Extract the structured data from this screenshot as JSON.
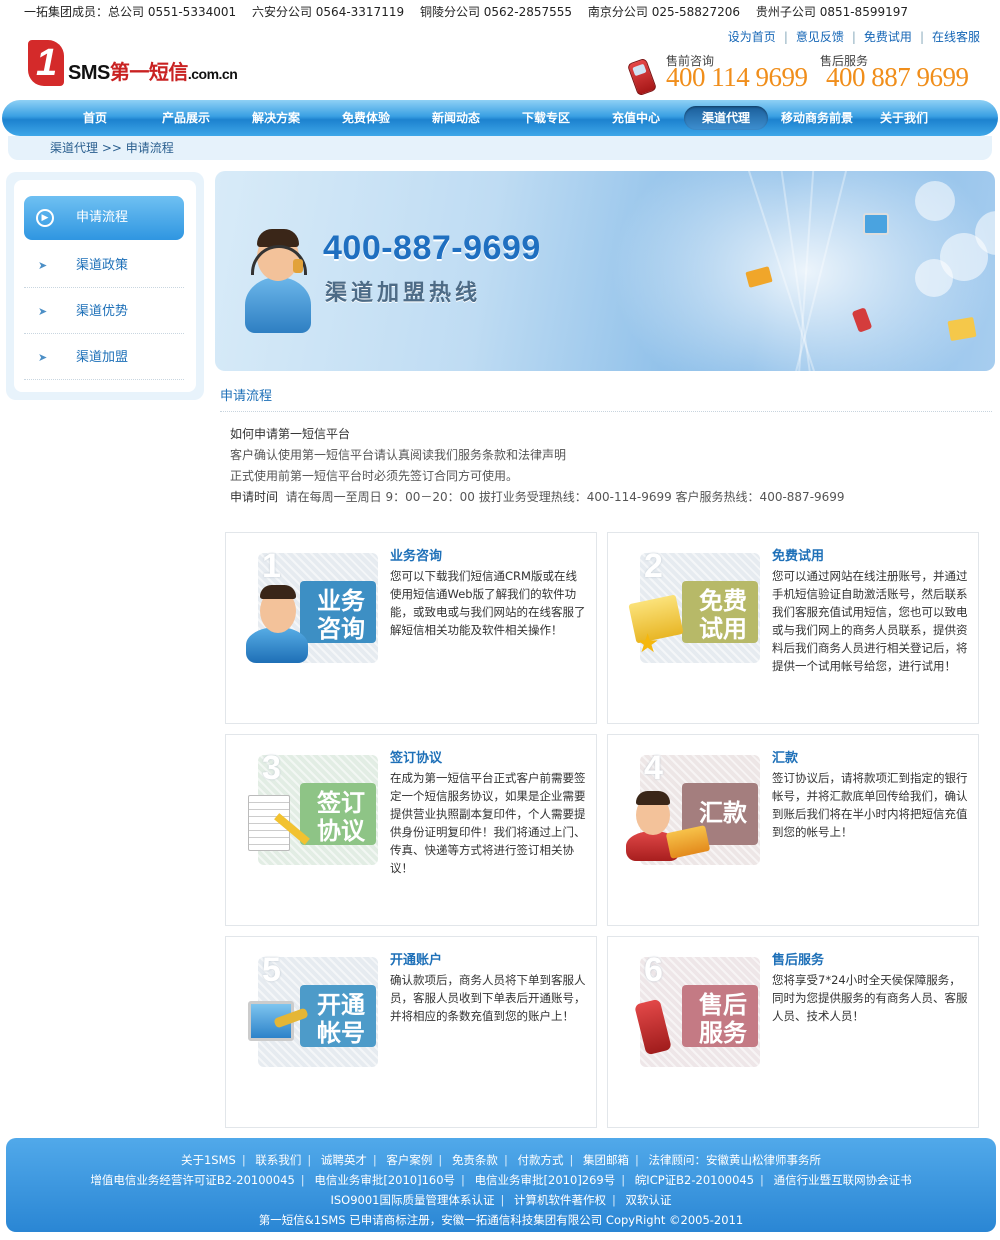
{
  "topbar": {
    "items": [
      "一拓集团成员：总公司 0551-5334001",
      "六安分公司 0564-3317119",
      "铜陵分公司 0562-2857555",
      "南京分公司 025-58827206",
      "贵州子公司 0851-8599197"
    ]
  },
  "header": {
    "logo_mark": "1",
    "logo_sms": "SMS",
    "logo_cn": "第一短信",
    "logo_domain": ".com.cn",
    "links": [
      "设为首页",
      "意见反馈",
      "免费试用",
      "在线客服"
    ],
    "presale_label": "售前咨询",
    "presale_number": "400 114 9699",
    "aftersale_label": "售后服务",
    "aftersale_number": "400 887 9699"
  },
  "nav": {
    "items": [
      "首页",
      "产品展示",
      "解决方案",
      "免费体验",
      "新闻动态",
      "下载专区",
      "充值中心",
      "渠道代理",
      "移动商务前景",
      "关于我们"
    ],
    "active": "渠道代理"
  },
  "breadcrumb": {
    "parent": "渠道代理",
    "sep": ">>",
    "current": "申请流程"
  },
  "sidebar": {
    "items": [
      "申请流程",
      "渠道政策",
      "渠道优势",
      "渠道加盟"
    ],
    "active": "申请流程"
  },
  "banner": {
    "number": "400-887-9699",
    "subtitle": "渠道加盟热线"
  },
  "section": {
    "title": "申请流程",
    "intro": {
      "line1": "如何申请第一短信平台",
      "line2": "客户确认使用第一短信平台请认真阅读我们服务条款和法律声明",
      "line3": "正式使用前第一短信平台时必须先签订合同方可使用。",
      "time_label": "申请时间",
      "time_text": "请在每周一至周日 9：00－20：00 拔打业务受理热线：400-114-9699 客户服务热线：400-887-9699"
    }
  },
  "steps": [
    {
      "num": "1",
      "tile": "业务咨询",
      "title": "业务咨询",
      "color": "#3d8fc4",
      "text": "您可以下载我们短信通CRM版或在线使用短信通Web版了解我们的软件功能，或致电或与我们网站的在线客服了解短信相关功能及软件相关操作！"
    },
    {
      "num": "2",
      "tile": "免费试用",
      "title": "免费试用",
      "color": "#b7b968",
      "text": "您可以通过网站在线注册账号，并通过手机短信验证自助激活账号，然后联系我们客服充值试用短信，您也可以致电或与我们网上的商务人员联系，提供资料后我们商务人员进行相关登记后，将提供一个试用帐号给您，进行试用！"
    },
    {
      "num": "3",
      "tile": "签订协议",
      "title": "签订协议",
      "color": "#8ec486",
      "text": "在成为第一短信平台正式客户前需要签定一个短信服务协议，如果是企业需要提供营业执照副本复印件，个人需要提供身份证明复印件！我们将通过上门、传真、快递等方式将进行签订相关协议！"
    },
    {
      "num": "4",
      "tile": "汇款",
      "title": "汇款",
      "color": "#a47e7e",
      "text": "签订协议后，请将款项汇到指定的银行帐号，并将汇款底单回传给我们，确认到账后我们将在半小时内将把短信充值到您的帐号上！"
    },
    {
      "num": "5",
      "tile": "开通帐号",
      "title": "开通账户",
      "color": "#4d9bc9",
      "text": "确认款项后，商务人员将下单到客服人员，客服人员收到下单表后开通账号，并将相应的条数充值到您的账户上！"
    },
    {
      "num": "6",
      "tile": "售后服务",
      "title": "售后服务",
      "color": "#c47a84",
      "text": "您将享受7*24小时全天侯保障服务，同时为您提供服务的有商务人员、客服人员、技术人员！"
    }
  ],
  "footer": {
    "row1": [
      "关于1SMS",
      "联系我们",
      "诚聘英才",
      "客户案例",
      "免责条款",
      "付款方式",
      "集团邮箱",
      "法律顾问：安徽黄山松律师事务所"
    ],
    "row2": [
      "增值电信业务经营许可证B2-20100045",
      "电信业务审批[2010]160号",
      "电信业务审批[2010]269号",
      "皖ICP证B2-20100045",
      "通信行业暨互联网协会证书"
    ],
    "row3": [
      "ISO9001国际质量管理体系认证",
      "计算机软件著作权",
      "双软认证"
    ],
    "row4": "第一短信&1SMS 已申请商标注册，安徽一拓通信科技集团有限公司 CopyRight ©2005-2011"
  },
  "colors": {
    "accent": "#1e70b8",
    "hotline": "#f08e1b",
    "nav": "#2a8ad8"
  }
}
